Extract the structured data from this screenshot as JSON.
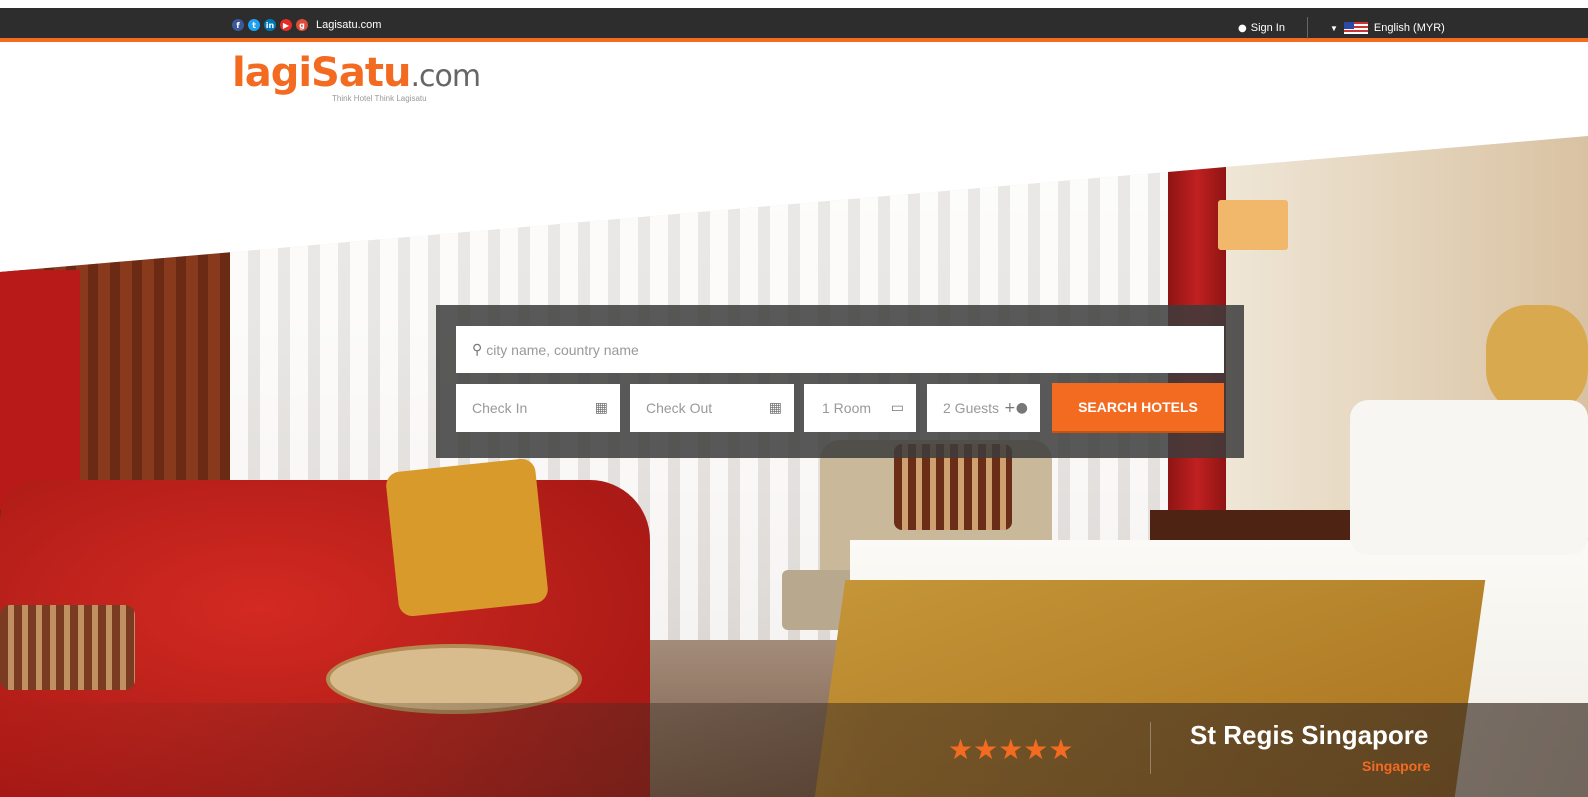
{
  "topbar": {
    "social_icons": [
      "facebook-icon",
      "twitter-icon",
      "linkedin-icon",
      "youtube-icon",
      "google-plus-icon"
    ],
    "site_link": "Lagisatu.com",
    "signin_label": "Sign In",
    "language_label": "English (MYR)"
  },
  "logo": {
    "lagi": "lagi",
    "satu": "Satu",
    "com": ".com",
    "tagline": "Think Hotel Think Lagisatu"
  },
  "search": {
    "destination_placeholder": "city name, country name",
    "checkin_label": "Check In",
    "checkout_label": "Check Out",
    "room_label": "1 Room",
    "guests_label": "2 Guests",
    "button_label": "SEARCH HOTELS"
  },
  "featured": {
    "stars": "★★★★★",
    "hotel_name": "St Regis Singapore",
    "city": "Singapore"
  },
  "colors": {
    "accent": "#f36b21",
    "topbar": "#2d2d2d"
  }
}
